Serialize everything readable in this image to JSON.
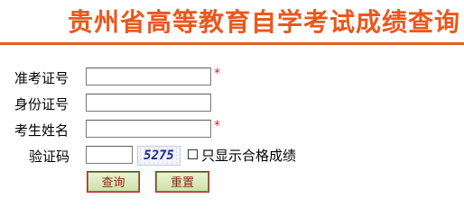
{
  "header": {
    "title": "贵州省高等教育自学考试成绩查询"
  },
  "form": {
    "exam_id": {
      "label": "准考证号",
      "value": "",
      "required_mark": "*"
    },
    "id_number": {
      "label": "身份证号",
      "value": ""
    },
    "name": {
      "label": "考生姓名",
      "value": "",
      "required_mark": "*"
    },
    "captcha": {
      "label": "验证码",
      "value": "",
      "code": "5275"
    },
    "pass_only": {
      "label": "只显示合格成绩",
      "checked": false
    }
  },
  "buttons": {
    "query": "查询",
    "reset": "重置"
  },
  "colors": {
    "accent": "#e8581d",
    "required": "#e02020",
    "button_text": "#8b2a12"
  }
}
